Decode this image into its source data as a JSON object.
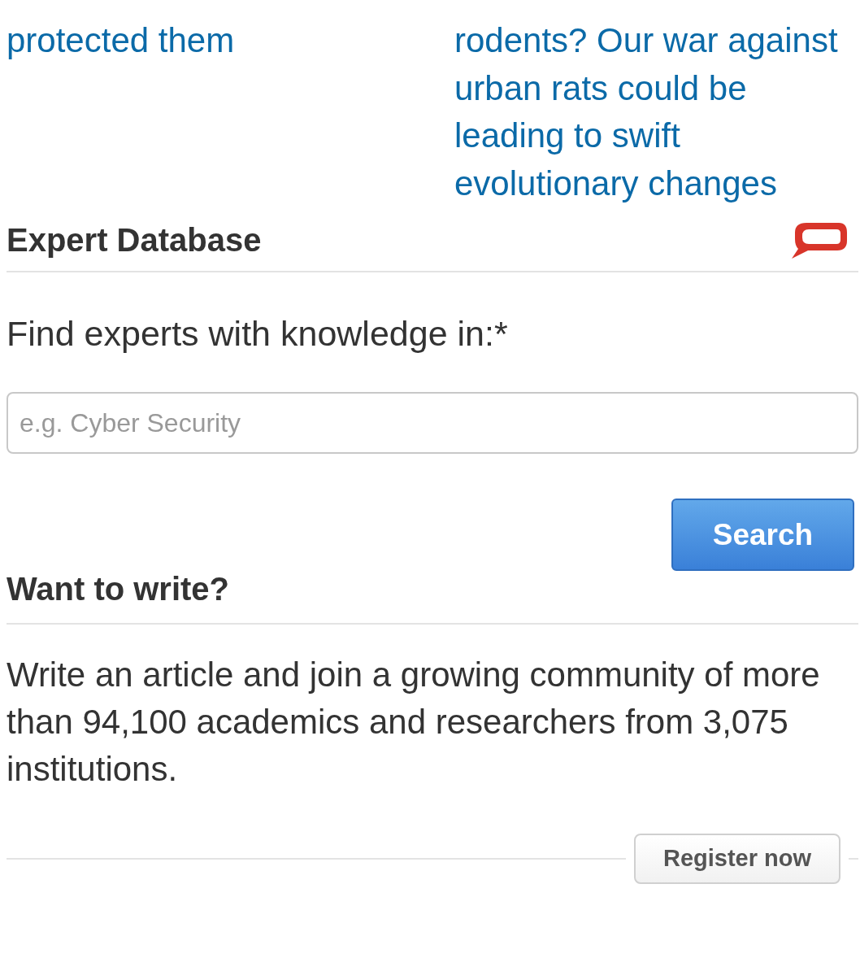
{
  "related_articles": [
    {
      "title": "protected them"
    },
    {
      "title": "rodents? Our war against urban rats could be leading to swift evolutionary changes"
    }
  ],
  "expert_database": {
    "heading": "Expert Database",
    "label": "Find experts with knowledge in:*",
    "placeholder": "e.g. Cyber Security",
    "button": "Search"
  },
  "want_to_write": {
    "heading": "Want to write?",
    "text": "Write an article and join a growing community of more than 94,100 academics and researchers from 3,075 institutions.",
    "button": "Register now"
  }
}
